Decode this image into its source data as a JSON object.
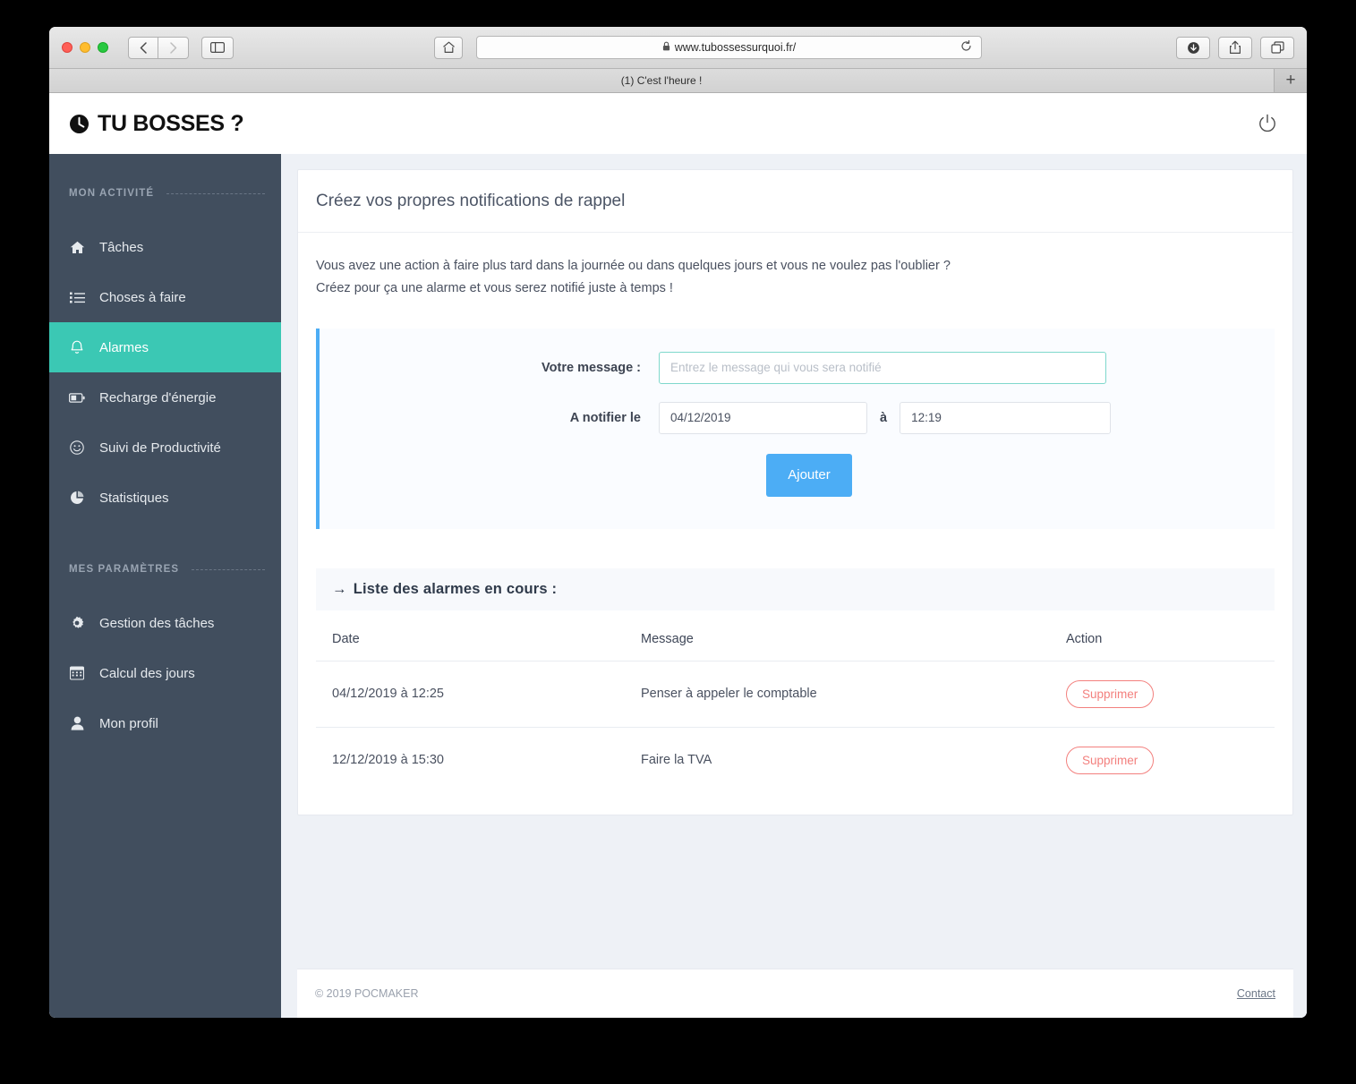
{
  "browser": {
    "url": "www.tubossessurquoi.fr/",
    "lock_icon": "padlock-icon",
    "tab_title": "(1) C'est l'heure !",
    "new_tab_label": "+",
    "back_label": "‹",
    "forward_label": "›",
    "reload_label": "↻"
  },
  "brand": {
    "title": "TU BOSSES ?",
    "icon": "clock-icon"
  },
  "sidebar": {
    "sections": [
      {
        "heading": "MON ACTIVITÉ",
        "items": [
          {
            "label": "Tâches",
            "icon": "home-icon",
            "active": false
          },
          {
            "label": "Choses à faire",
            "icon": "list-icon",
            "active": false
          },
          {
            "label": "Alarmes",
            "icon": "bell-icon",
            "active": true
          },
          {
            "label": "Recharge d'énergie",
            "icon": "battery-icon",
            "active": false
          },
          {
            "label": "Suivi de Productivité",
            "icon": "smiley-icon",
            "active": false
          },
          {
            "label": "Statistiques",
            "icon": "pie-chart-icon",
            "active": false
          }
        ]
      },
      {
        "heading": "MES PARAMÈTRES",
        "items": [
          {
            "label": "Gestion des tâches",
            "icon": "gear-icon",
            "active": false
          },
          {
            "label": "Calcul des jours",
            "icon": "calendar-icon",
            "active": false
          },
          {
            "label": "Mon profil",
            "icon": "user-icon",
            "active": false
          }
        ]
      }
    ]
  },
  "topbar": {
    "power_icon": "power-icon"
  },
  "main": {
    "card_title": "Créez vos propres notifications de rappel",
    "intro_line1": "Vous avez une action à faire plus tard dans la journée ou dans quelques jours et vous ne voulez pas l'oublier ?",
    "intro_line2": "Créez pour ça une alarme et vous serez notifié juste à temps !",
    "form": {
      "message_label": "Votre message :",
      "message_value": "",
      "message_placeholder": "Entrez le message qui vous sera notifié",
      "date_label": "A notifier le",
      "date_value": "04/12/2019",
      "separator": "à",
      "time_value": "12:19",
      "submit_label": "Ajouter"
    },
    "list": {
      "heading": "Liste des alarmes en cours :",
      "heading_arrow": "→",
      "columns": [
        "Date",
        "Message",
        "Action"
      ],
      "rows": [
        {
          "date": "04/12/2019 à 12:25",
          "message": "Penser à appeler le comptable",
          "action": "Supprimer"
        },
        {
          "date": "12/12/2019 à 15:30",
          "message": "Faire la TVA",
          "action": "Supprimer"
        }
      ]
    }
  },
  "footer": {
    "copyright": "© 2019 POCMAKER",
    "contact": "Contact"
  },
  "colors": {
    "accent_teal": "#3bc8b4",
    "accent_blue": "#4cadf5",
    "danger_red": "#f3807e",
    "sidebar_bg": "#414e5e",
    "page_bg": "#eef1f6"
  }
}
